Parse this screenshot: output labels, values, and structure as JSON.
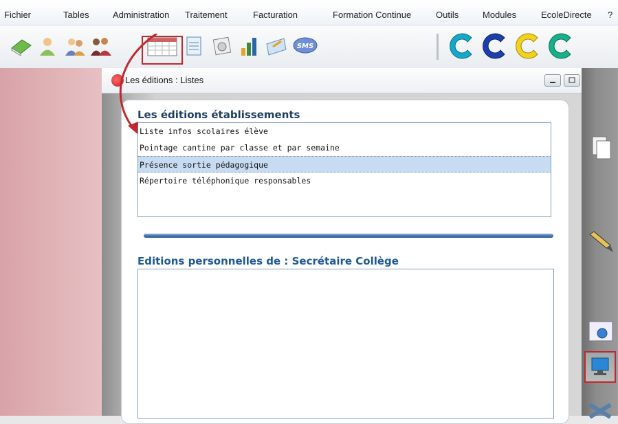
{
  "menu": [
    "Fichier",
    "Tables",
    "Administration",
    "Traitement",
    "Facturation",
    "Formation Continue",
    "Outils",
    "Modules",
    "EcoleDirecte",
    "?"
  ],
  "window": {
    "title": "Les éditions : Listes"
  },
  "section1": {
    "title": "Les éditions établissements",
    "items": [
      "Liste infos scolaires élève",
      "Pointage cantine par classe et par semaine",
      "Présence sortie pédagogique",
      "Répertoire téléphonique responsables"
    ],
    "selected_index": 2
  },
  "section2": {
    "title": "Editions personnelles de : Secrétaire Collège"
  },
  "colors": {
    "accent": "#1e3d63",
    "highlight_box": "#c0282e",
    "selection": "#c7dcf2"
  },
  "toolbar_icons": [
    "book-icon",
    "user-icon",
    "users-icon",
    "group-icon",
    "calendar-icon",
    "document-icon",
    "form-icon",
    "chart-icon",
    "mail-icon",
    "sms-icon",
    "logo-cyan-icon",
    "logo-blue-icon",
    "logo-yellow-icon",
    "logo-green-icon"
  ]
}
